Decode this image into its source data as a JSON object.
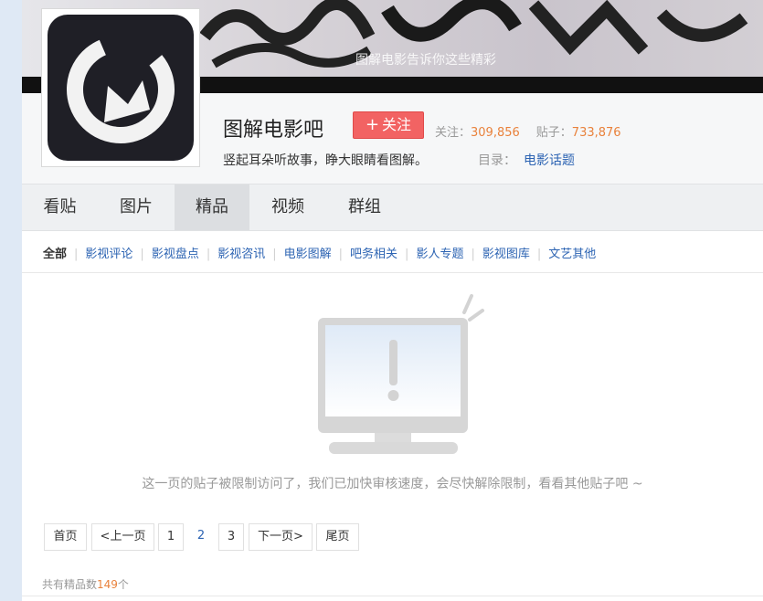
{
  "banner": {
    "overlay_text": "图解电影告诉你这些精彩"
  },
  "forum": {
    "title": "图解电影吧",
    "follow_label": "关注",
    "follow_plus": "+",
    "stats": {
      "follow_label": "关注：",
      "follow_count": "309,856",
      "posts_label": "贴子：",
      "posts_count": "733,876"
    },
    "slogan": "竖起耳朵听故事，睁大眼睛看图解。",
    "directory_label": "目录：",
    "directory_link": "电影话题"
  },
  "tabs": [
    {
      "label": "看贴"
    },
    {
      "label": "图片"
    },
    {
      "label": "精品",
      "active": true
    },
    {
      "label": "视频"
    },
    {
      "label": "群组"
    }
  ],
  "subnav": [
    {
      "label": "全部",
      "active": true
    },
    {
      "label": "影视评论"
    },
    {
      "label": "影视盘点"
    },
    {
      "label": "影视咨讯"
    },
    {
      "label": "电影图解"
    },
    {
      "label": "吧务相关"
    },
    {
      "label": "影人专题"
    },
    {
      "label": "影视图库"
    },
    {
      "label": "文艺其他"
    }
  ],
  "empty": {
    "icon": "monitor-warning-icon",
    "message": "这一页的贴子被限制访问了，我们已加快审核速度，会尽快解除限制，看看其他贴子吧 ~"
  },
  "pager": {
    "first": "首页",
    "prev": "<上一页",
    "pages": [
      "1",
      "2",
      "3"
    ],
    "current": "2",
    "next": "下一页>",
    "last": "尾页"
  },
  "total": {
    "prefix": "共有精品数",
    "count": "149",
    "suffix": "个"
  },
  "colors": {
    "follow_button": "#f26363",
    "link": "#2d64b3",
    "count": "#e9823c"
  }
}
